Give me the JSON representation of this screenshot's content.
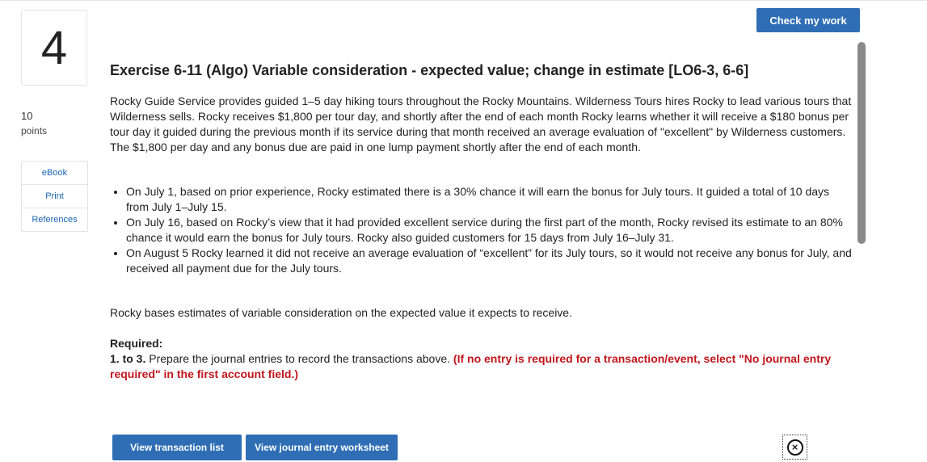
{
  "question": {
    "number": "4",
    "points_value": "10",
    "points_label": "points"
  },
  "side_links": [
    "eBook",
    "Print",
    "References"
  ],
  "toolbar": {
    "check_label": "Check my work"
  },
  "exercise": {
    "title": "Exercise 6-11 (Algo) Variable consideration - expected value; change in estimate [LO6-3, 6-6]",
    "intro": "Rocky Guide Service provides guided 1–5 day hiking tours throughout the Rocky Mountains. Wilderness Tours hires Rocky to lead various tours that Wilderness sells. Rocky receives $1,800 per tour day, and shortly after the end of each month Rocky learns whether it will receive a $180 bonus per tour day it guided during the previous month if its service during that month received an average evaluation of \"excellent\" by Wilderness customers. The $1,800 per day and any bonus due are paid in one lump payment shortly after the end of each month.",
    "bullets": [
      "On July 1, based on prior experience, Rocky estimated there is a 30% chance it will earn the bonus for July tours. It guided a total of 10 days from July 1–July 15.",
      "On July 16, based on Rocky’s view that it had provided excellent service during the first part of the month, Rocky revised its estimate to an 80% chance it would earn the bonus for July tours. Rocky also guided customers for 15 days from July 16–July 31.",
      "On August 5 Rocky learned it did not receive an average evaluation of “excellent” for its July tours, so it would not receive any bonus for July, and received all payment due for the July tours."
    ],
    "basis": "Rocky bases estimates of variable consideration on the expected value it expects to receive.",
    "required_label": "Required:",
    "steps_label": "1. to 3.",
    "steps_text": "Prepare the journal entries to record the transactions above.",
    "instruction": "(If no entry is required for a transaction/event, select \"No journal entry required\" in the first account field.)"
  },
  "actions": {
    "view_list": "View transaction list",
    "view_worksheet": "View journal entry worksheet"
  },
  "colors": {
    "accent": "#2f6eb5",
    "instruction_red": "#c0161c",
    "link": "#1b66b3"
  }
}
